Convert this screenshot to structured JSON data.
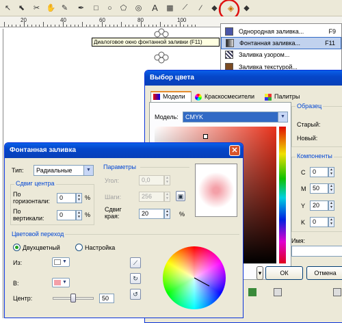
{
  "toolbar": {
    "icons": [
      "pointer-icon",
      "shape-icon",
      "crop-icon",
      "hand-icon",
      "freehand-icon",
      "smart-fill-icon",
      "rectangle-icon",
      "ellipse-icon",
      "polygon-icon",
      "spiral-icon",
      "text-icon",
      "table-icon",
      "eyedropper-icon",
      "interactive-fill-icon",
      "fill-icon"
    ]
  },
  "ruler": {
    "marks": [
      "20",
      "40",
      "60",
      "80",
      "100"
    ]
  },
  "tooltip": "Диалоговое окно фонтанной заливки (F11)",
  "fill_menu": {
    "items": [
      {
        "label": "Однородная заливка...",
        "shortcut": "F9"
      },
      {
        "label": "Фонтанная заливка...",
        "shortcut": "F11"
      },
      {
        "label": "Заливка узором...",
        "shortcut": ""
      },
      {
        "label": "Заливка текстурой...",
        "shortcut": ""
      }
    ]
  },
  "color_dialog": {
    "title": "Выбор цвета",
    "tabs": [
      "Модели",
      "Краскосмесители",
      "Палитры"
    ],
    "model_label": "Модель:",
    "model_value": "CMYK",
    "sample_group": "Образец",
    "old_label": "Старый:",
    "new_label": "Новый:",
    "components_group": "Компоненты",
    "components": [
      {
        "name": "C",
        "value": "0"
      },
      {
        "name": "M",
        "value": "50"
      },
      {
        "name": "Y",
        "value": "20"
      },
      {
        "name": "K",
        "value": "0"
      }
    ],
    "name_label": "Имя:",
    "ok": "ОК",
    "cancel": "Отмена"
  },
  "fountain_dialog": {
    "title": "Фонтанная заливка",
    "type_label": "Тип:",
    "type_value": "Радиальные",
    "center_group": "Сдвиг центра",
    "horizontal_label_1": "По",
    "horizontal_label_2": "горизонтали:",
    "horizontal_value": "0",
    "vertical_label_1": "По",
    "vertical_label_2": "вертикали:",
    "vertical_value": "0",
    "percent": "%",
    "params_group": "Параметры",
    "angle_label": "Угол:",
    "angle_value": "0,0",
    "steps_label": "Шаги:",
    "steps_value": "256",
    "edge_label_1": "Сдвиг",
    "edge_label_2": "края:",
    "edge_value": "20",
    "transition_group": "Цветовой переход",
    "two_color": "Двухцветный",
    "custom": "Настройка",
    "from_label": "Из:",
    "to_label": "В:",
    "midpoint_label": "Центр:",
    "midpoint_value": "50",
    "midpoint_fraction": 0.5,
    "from_color": "#ffffff",
    "to_color": "#f4a0a8"
  }
}
